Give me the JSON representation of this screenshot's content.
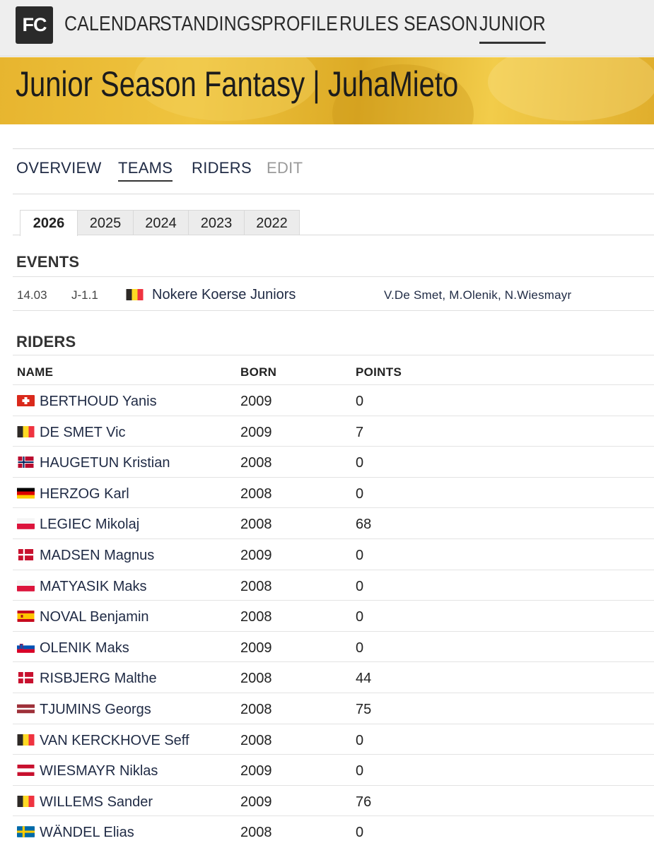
{
  "app": {
    "logo": "FC",
    "nav": [
      {
        "label": "CALENDAR",
        "active": false
      },
      {
        "label": "STANDINGS",
        "active": false
      },
      {
        "label": "PROFILE",
        "active": false
      },
      {
        "label": "RULES",
        "active": false
      },
      {
        "label": "SEASON",
        "active": false
      },
      {
        "label": "JUNIOR",
        "active": true
      }
    ]
  },
  "banner": {
    "title": "Junior Season Fantasy | JuhaMieto"
  },
  "subtabs": [
    {
      "label": "OVERVIEW",
      "state": "normal"
    },
    {
      "label": "TEAMS",
      "state": "active"
    },
    {
      "label": "RIDERS",
      "state": "normal"
    },
    {
      "label": "EDIT",
      "state": "disabled"
    }
  ],
  "years": [
    {
      "label": "2026",
      "active": true
    },
    {
      "label": "2025",
      "active": false
    },
    {
      "label": "2024",
      "active": false
    },
    {
      "label": "2023",
      "active": false
    },
    {
      "label": "2022",
      "active": false
    }
  ],
  "events": {
    "title": "EVENTS",
    "rows": [
      {
        "date": "14.03",
        "class": "J-1.1",
        "flag": "be-flag-icon",
        "name": "Nokere Koerse Juniors",
        "riders": "V.De Smet, M.Olenik, N.Wiesmayr"
      }
    ]
  },
  "riders": {
    "title": "RIDERS",
    "headers": {
      "name": "NAME",
      "born": "BORN",
      "points": "POINTS"
    },
    "rows": [
      {
        "flag": "ch-flag-icon",
        "name": "BERTHOUD Yanis",
        "born": "2009",
        "points": "0"
      },
      {
        "flag": "be-flag-icon",
        "name": "DE SMET Vic",
        "born": "2009",
        "points": "7"
      },
      {
        "flag": "no-flag-icon",
        "name": "HAUGETUN Kristian",
        "born": "2008",
        "points": "0"
      },
      {
        "flag": "de-flag-icon",
        "name": "HERZOG Karl",
        "born": "2008",
        "points": "0"
      },
      {
        "flag": "pl-flag-icon",
        "name": "LEGIEC Mikolaj",
        "born": "2008",
        "points": "68"
      },
      {
        "flag": "dk-flag-icon",
        "name": "MADSEN Magnus",
        "born": "2009",
        "points": "0"
      },
      {
        "flag": "pl-flag-icon",
        "name": "MATYASIK Maks",
        "born": "2008",
        "points": "0"
      },
      {
        "flag": "es-flag-icon",
        "name": "NOVAL Benjamin",
        "born": "2008",
        "points": "0"
      },
      {
        "flag": "si-flag-icon",
        "name": "OLENIK Maks",
        "born": "2009",
        "points": "0"
      },
      {
        "flag": "dk-flag-icon",
        "name": "RISBJERG Malthe",
        "born": "2008",
        "points": "44"
      },
      {
        "flag": "lv-flag-icon",
        "name": "TJUMINS Georgs",
        "born": "2008",
        "points": "75"
      },
      {
        "flag": "be-flag-icon",
        "name": "VAN KERCKHOVE Seff",
        "born": "2008",
        "points": "0"
      },
      {
        "flag": "at-flag-icon",
        "name": "WIESMAYR Niklas",
        "born": "2009",
        "points": "0"
      },
      {
        "flag": "be-flag-icon",
        "name": "WILLEMS Sander",
        "born": "2009",
        "points": "76"
      },
      {
        "flag": "se-flag-icon",
        "name": "WÄNDEL Elias",
        "born": "2008",
        "points": "0"
      }
    ]
  }
}
